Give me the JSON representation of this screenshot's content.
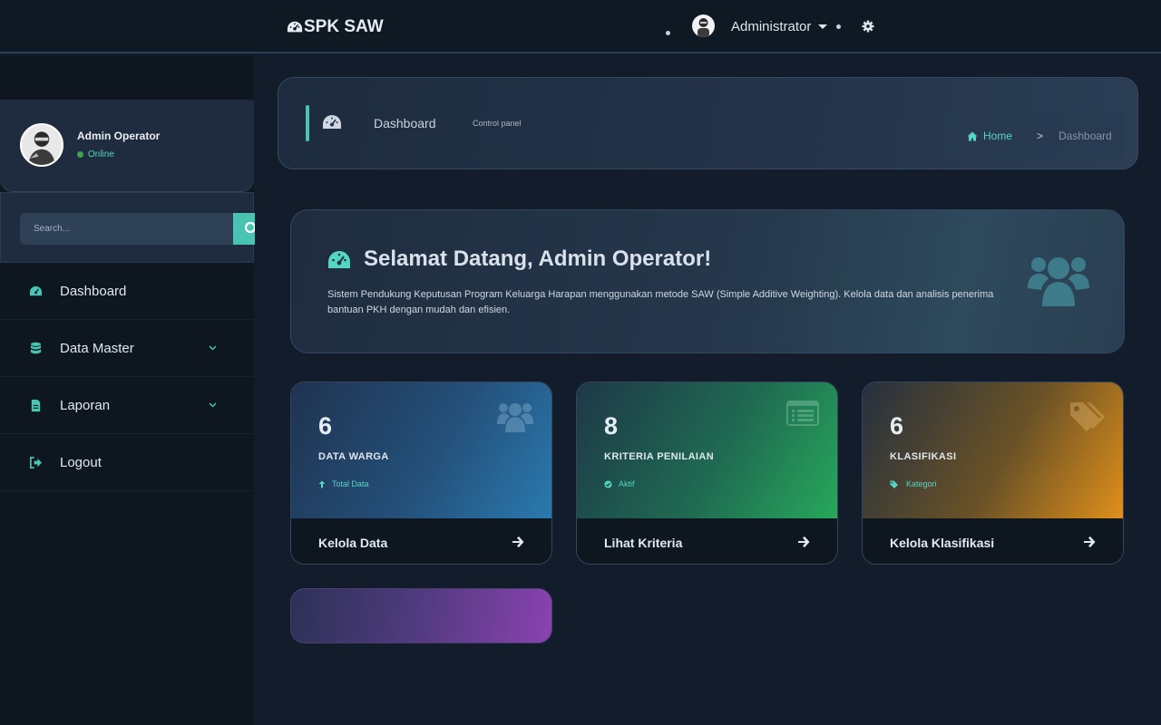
{
  "app": {
    "brand": "SPK SAW"
  },
  "navbar": {
    "username": "Administrator"
  },
  "sidebar": {
    "user": {
      "name": "Admin Operator",
      "status": "Online"
    },
    "search": {
      "placeholder": "Search..."
    },
    "items": [
      {
        "label": "Dashboard",
        "icon": "dashboard-icon"
      },
      {
        "label": "Data Master",
        "icon": "database-icon",
        "expandable": true
      },
      {
        "label": "Laporan",
        "icon": "file-icon",
        "expandable": true
      },
      {
        "label": "Logout",
        "icon": "logout-icon"
      }
    ]
  },
  "content_header": {
    "title": "Dashboard",
    "subtitle": "Control panel",
    "breadcrumb": {
      "home": "Home",
      "separator": ">",
      "current": "Dashboard"
    }
  },
  "welcome": {
    "title": "Selamat Datang, Admin Operator!",
    "text": "Sistem Pendukung Keputusan Program Keluarga Harapan menggunakan metode SAW (Simple Additive Weighting). Kelola data dan analisis penerima bantuan PKH dengan mudah dan efisien."
  },
  "cards": [
    {
      "value": "6",
      "label": "DATA WARGA",
      "meta": "Total Data",
      "link": "Kelola Data",
      "color_start": "#1f3350",
      "color_end": "#2a7ab0"
    },
    {
      "value": "8",
      "label": "KRITERIA PENILAIAN",
      "meta": "Aktif",
      "link": "Lihat Kriteria",
      "color_start": "#1e3848",
      "color_end": "#27a85a"
    },
    {
      "value": "6",
      "label": "KLASIFIKASI",
      "meta": "Kategori",
      "link": "Kelola Klasifikasi",
      "color_start": "#25303f",
      "color_end": "#e08f1a"
    }
  ],
  "colors": {
    "accent": "#49c4b2",
    "online": "#3fa34d"
  }
}
